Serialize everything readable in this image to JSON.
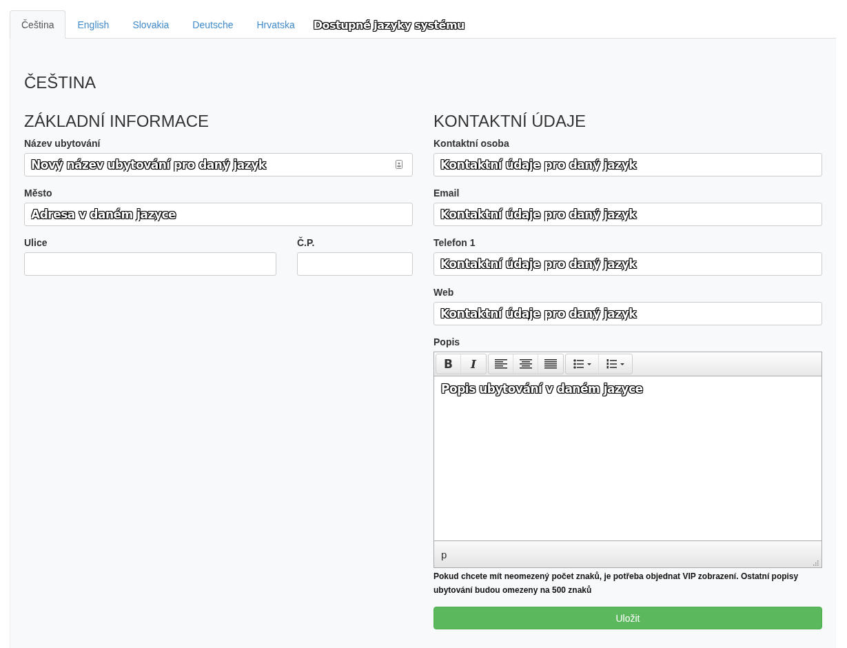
{
  "tabs": [
    {
      "label": "Čeština",
      "selected": true
    },
    {
      "label": "English",
      "selected": false
    },
    {
      "label": "Slovakia",
      "selected": false
    },
    {
      "label": "Deutsche",
      "selected": false
    },
    {
      "label": "Hrvatska",
      "selected": false
    }
  ],
  "tabs_annotation": "Dostupné jazyky systému",
  "heading": "ČEŠTINA",
  "basic": {
    "title": "ZÁKLADNÍ INFORMACE",
    "fields": [
      {
        "label": "Název ubytování",
        "value": "Nový název ubytování pro daný jazyk",
        "kind": "contact-card"
      },
      {
        "label": "Město",
        "value": "Adresa v daném jazyce",
        "kind": "plain"
      }
    ],
    "street": {
      "label": "Ulice"
    },
    "number": {
      "label": "Č.P."
    }
  },
  "contact": {
    "title": "KONTAKTNÍ ÚDAJE",
    "fields": [
      {
        "label": "Kontaktní osoba",
        "value": "Kontaktní údaje pro daný jazyk"
      },
      {
        "label": "Email",
        "value": "Kontaktní údaje pro daný jazyk"
      },
      {
        "label": "Telefon 1",
        "value": "Kontaktní údaje pro daný jazyk"
      },
      {
        "label": "Web",
        "value": "Kontaktní údaje pro daný jazyk"
      }
    ]
  },
  "editor": {
    "label": "Popis",
    "toolbar": [
      [
        {
          "kind": "bold",
          "text": "B"
        },
        {
          "kind": "italic",
          "text": "I"
        }
      ],
      [
        {
          "kind": "align-left"
        },
        {
          "kind": "align-center"
        },
        {
          "kind": "justify"
        }
      ],
      [
        {
          "kind": "bullet-list"
        },
        {
          "kind": "numbered-list"
        }
      ]
    ],
    "value": "Popis ubytování v daném jazyce",
    "path": "p"
  },
  "note": "Pokud chcete mít neomezený počet znaků, je potřeba objednat VIP zobrazení. Ostatní popisy ubytování budou omezeny na 500 znaků",
  "save": "Uložit"
}
